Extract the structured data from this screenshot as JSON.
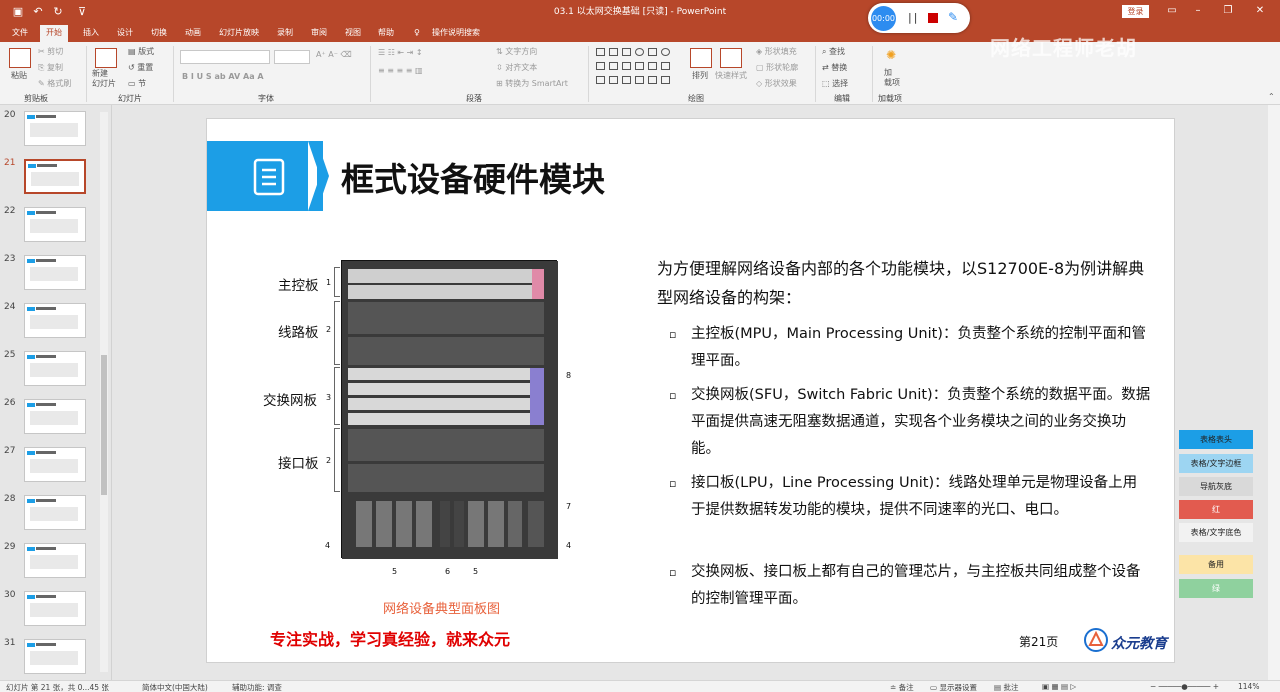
{
  "app": {
    "doc_title": "03.1 以太网交换基础 [只读]  -  PowerPoint",
    "login": "登录",
    "watermark": "网络工程师老胡"
  },
  "recorder": {
    "time": "00:00",
    "pause": "||"
  },
  "tabs": [
    "文件",
    "开始",
    "插入",
    "设计",
    "切换",
    "动画",
    "幻灯片放映",
    "录制",
    "审阅",
    "视图",
    "帮助",
    "操作说明搜索"
  ],
  "ribbon": {
    "clipboard": {
      "label": "剪贴板",
      "paste": "粘贴",
      "cut": "剪切",
      "copy": "复制",
      "format_painter": "格式刷"
    },
    "slides": {
      "label": "幻灯片",
      "new_slide": "新建\n幻灯片",
      "layout": "版式",
      "reset": "重置",
      "section": "节"
    },
    "font": {
      "label": "字体"
    },
    "paragraph": {
      "label": "段落",
      "text_dir": "文字方向",
      "align_text": "对齐文本",
      "smartart": "转换为 SmartArt"
    },
    "drawing": {
      "label": "绘图",
      "arrange": "排列",
      "quick_styles": "快速样式",
      "fill": "形状填充",
      "outline": "形状轮廓",
      "effects": "形状效果"
    },
    "editing": {
      "label": "编辑",
      "find": "查找",
      "replace": "替换",
      "select": "选择"
    },
    "addins": {
      "label": "加载项",
      "addin": "加\n载项"
    }
  },
  "thumbnails": [
    {
      "num": "20"
    },
    {
      "num": "21"
    },
    {
      "num": "22"
    },
    {
      "num": "23"
    },
    {
      "num": "24"
    },
    {
      "num": "25"
    },
    {
      "num": "26"
    },
    {
      "num": "27"
    },
    {
      "num": "28"
    },
    {
      "num": "29"
    },
    {
      "num": "30"
    },
    {
      "num": "31"
    }
  ],
  "slide": {
    "title": "框式设备硬件模块",
    "intro": "为方便理解网络设备内部的各个功能模块，以S12700E-8为例讲解典型网络设备的构架：",
    "bullets": [
      "主控板(MPU，Main Processing Unit)：负责整个系统的控制平面和管理平面。",
      "交换网板(SFU，Switch Fabric Unit)：负责整个系统的数据平面。数据平面提供高速无阻塞数据通道，实现各个业务模块之间的业务交换功能。",
      "接口板(LPU，Line Processing Unit)：线路处理单元是物理设备上用于提供数据转发功能的模块，提供不同速率的光口、电口。",
      "交换网板、接口板上都有自己的管理芯片，与主控板共同组成整个设备的控制管理平面。"
    ],
    "bullet_mark": "▫",
    "figure_labels": {
      "mpu": "主控板",
      "lpu1": "线路板",
      "sfu": "交换网板",
      "lpu2": "接口板"
    },
    "figure_numbers": {
      "mpu": "1",
      "lpu1": "2",
      "sfu": "3",
      "lpu2": "2",
      "right8": "8",
      "right7": "7",
      "left4": "4",
      "right4": "4",
      "b5a": "5",
      "b6": "6",
      "b5b": "5"
    },
    "caption": "网络设备典型面板图",
    "slogan": "专注实战，学习真经验，就来众元",
    "page": "第21页",
    "logo": "众元教育"
  },
  "right_panel": [
    {
      "label": "表格表头",
      "color": "#1c9ee6"
    },
    {
      "label": "表格/文字边框",
      "color": "#9dd5f2"
    },
    {
      "label": "导航灰底",
      "color": "#d9d9d9"
    },
    {
      "label": "红",
      "color": "#e25b4f"
    },
    {
      "label": "表格/文字底色",
      "color": "#f2f2f2"
    },
    {
      "label": "备用",
      "color": "#fce4a7"
    },
    {
      "label": "绿",
      "color": "#8fd19e"
    }
  ],
  "status": {
    "slide_info": "幻灯片 第 21 张，共 0...45 张",
    "lang": "简体中文(中国大陆)",
    "accessibility": "辅助功能: 调查",
    "notes": "备注",
    "display": "显示器设置",
    "comments": "批注",
    "zoom": "114%"
  }
}
